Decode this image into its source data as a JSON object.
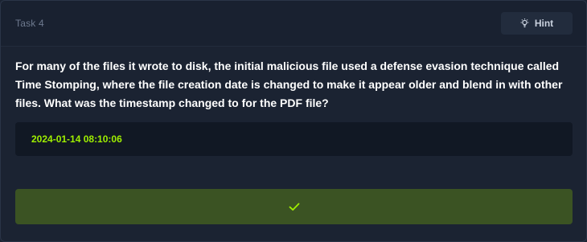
{
  "task": {
    "label": "Task 4",
    "hint_label": "Hint",
    "question": "For many of the files it wrote to disk, the initial malicious file used a defense evasion technique called Time Stomping, where the file creation date is changed to make it appear older and blend in with other files. What was the timestamp changed to for the PDF file?",
    "answer": "2024-01-14 08:10:06",
    "status": "correct"
  },
  "colors": {
    "accent": "#9fef00",
    "submit_bg": "#3b5323",
    "card_bg": "#1b2332",
    "answer_bg": "#111824"
  },
  "icons": {
    "hint": "lightbulb-icon",
    "submit": "checkmark-icon"
  }
}
